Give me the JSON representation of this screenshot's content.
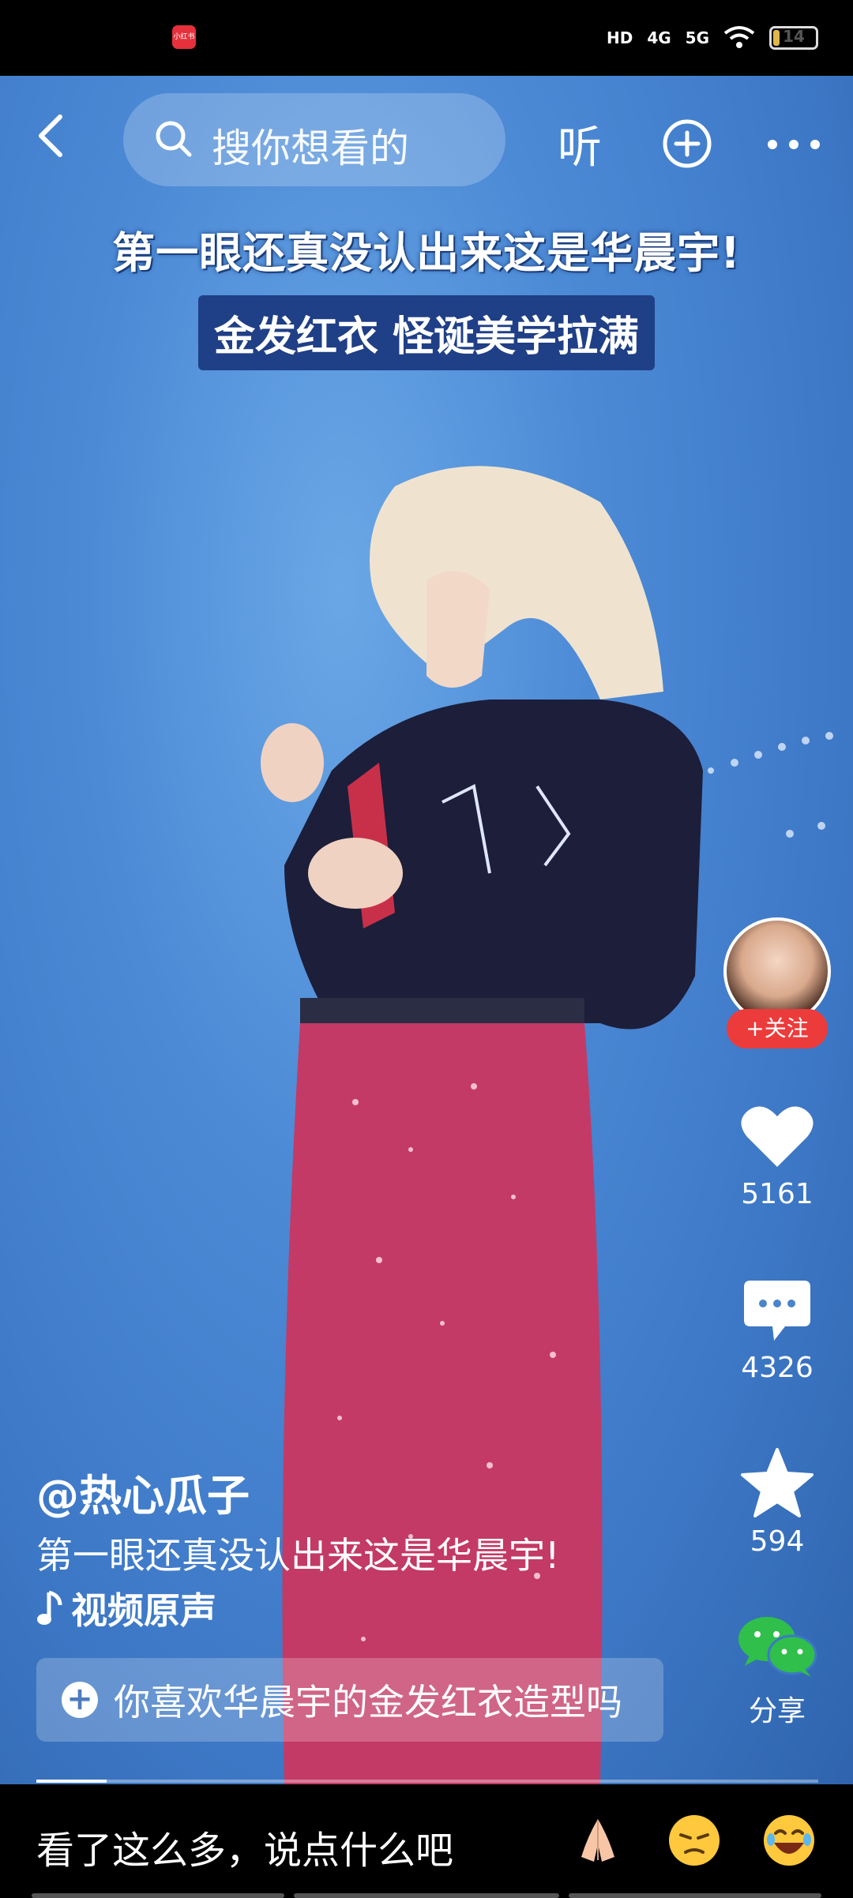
{
  "status": {
    "app_badge": "小红书",
    "hd": "HD",
    "net1": "4G",
    "net2": "5G",
    "battery": "14"
  },
  "topbar": {
    "search_placeholder": "搜你想看的",
    "listen_label": "听"
  },
  "video": {
    "caption_line1": "第一眼还真没认出来这是华晨宇!",
    "caption_line2": "金发红衣 怪诞美学拉满"
  },
  "rail": {
    "follow_label": "+关注",
    "likes": "5161",
    "comments": "4326",
    "favorites": "594",
    "share_label": "分享"
  },
  "post": {
    "author": "@热心瓜子",
    "description": "第一眼还真没认出来这是华晨宇!",
    "music": "视频原声",
    "topic": "你喜欢华晨宇的金发红衣造型吗"
  },
  "progress_fraction": 0.09,
  "bottom": {
    "comment_placeholder": "看了这么多，说点什么吧"
  },
  "colors": {
    "follow": "#ec3b3b",
    "caption_box": "#1f3f86",
    "wechat": "#2fbf4a"
  }
}
